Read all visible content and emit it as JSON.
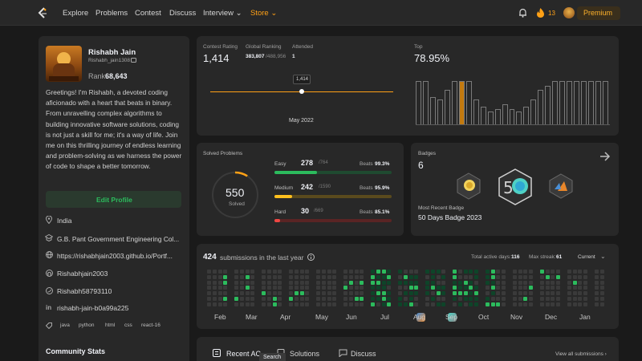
{
  "nav": {
    "items": [
      "Explore",
      "Problems",
      "Contest",
      "Discuss",
      "Interview",
      "Store"
    ],
    "streak": "13",
    "premium": "Premium"
  },
  "profile": {
    "name": "Rishabh Jain",
    "username": "Rishabh_jain1308",
    "rank_label": "Rank",
    "rank_value": "68,643",
    "bio": "Greetings! I'm Rishabh, a devoted coding aficionado with a heart that beats in binary. From unravelling complex algorithms to building innovative software solutions, coding is not just a skill for me; it's a way of life. Join me on this thrilling journey of endless learning and problem-solving as we harness the power of code to shape a better tomorrow.",
    "edit_button": "Edit Profile",
    "location": "India",
    "school": "G.B. Pant Government Engineering Col...",
    "website": "https://rishabhjain2003.github.io/Portf...",
    "github": "Rishabhjain2003",
    "twitter": "Rishabh58793110",
    "linkedin": "rishabh-jain-b0a99a225",
    "skills": [
      "java",
      "python",
      "html",
      "css",
      "react-16"
    ],
    "community_stats": "Community Stats"
  },
  "contest": {
    "rating_label": "Contest Rating",
    "rating_value": "1,414",
    "global_label": "Global Ranking",
    "global_value": "383,807",
    "global_total": "/488,956",
    "attended_label": "Attended",
    "attended_value": "1",
    "tooltip_value": "1,414",
    "date": "May 2022",
    "top_label": "Top",
    "top_value": "78.95%",
    "histogram": [
      0.95,
      0.95,
      0.6,
      0.55,
      0.75,
      0.95,
      0.95,
      0.95,
      0.55,
      0.4,
      0.3,
      0.35,
      0.45,
      0.35,
      0.3,
      0.4,
      0.55,
      0.75,
      0.85,
      0.95,
      0.95,
      0.95,
      0.95,
      0.95,
      0.95,
      0.95,
      0.95
    ]
  },
  "solved": {
    "title": "Solved Problems",
    "total": "550",
    "solved_label": "Solved",
    "beats_label": "Beats",
    "levels": [
      {
        "name": "Easy",
        "count": "278",
        "total": "/764",
        "beats": "99.3%",
        "fill": 0.364,
        "color": "#2cbb5d",
        "track": "#1f4a30"
      },
      {
        "name": "Medium",
        "count": "242",
        "total": "/1590",
        "beats": "95.9%",
        "fill": 0.152,
        "color": "#ffc01e",
        "track": "#5a4a1d"
      },
      {
        "name": "Hard",
        "count": "30",
        "total": "/669",
        "beats": "85.1%",
        "fill": 0.045,
        "color": "#ef4743",
        "track": "#5a2424"
      }
    ]
  },
  "badges": {
    "title": "Badges",
    "count": "6",
    "recent_label": "Most Recent Badge",
    "recent_name": "50 Days Badge 2023"
  },
  "submissions": {
    "count": "424",
    "label": "submissions in the last year",
    "active_label": "Total active days:",
    "active_value": "116",
    "streak_label": "Max streak:",
    "streak_value": "61",
    "period": "Current",
    "months": [
      "Feb",
      "Mar",
      "Apr",
      "May",
      "Jun",
      "Jul",
      "Aug",
      "Sep",
      "Oct",
      "Nov",
      "Dec",
      "Jan"
    ]
  },
  "tabs": {
    "recent": "Recent AC",
    "solutions": "Solutions",
    "discuss": "Discuss",
    "view_all": "View all submissions",
    "tooltip": "Search"
  }
}
